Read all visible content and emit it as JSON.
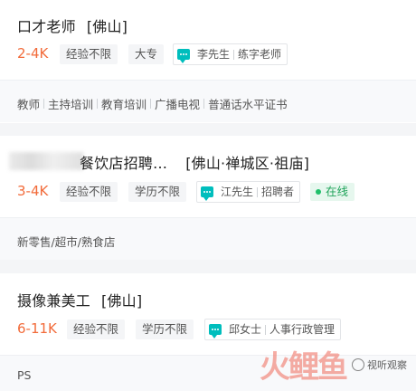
{
  "jobs": [
    {
      "title": "口才老师",
      "city": "[佛山]",
      "salary": "2-4K",
      "tags": [
        "经验不限",
        "大专"
      ],
      "recruiter_name": "李先生",
      "recruiter_role": "练字老师",
      "online": "",
      "industry": [
        "教师",
        "主持培训",
        "教育培训",
        "广播电视",
        "普通话水平证书"
      ]
    },
    {
      "title": "餐饮店招聘…",
      "city": "[佛山·禅城区·祖庙]",
      "salary": "3-4K",
      "tags": [
        "经验不限",
        "学历不限"
      ],
      "recruiter_name": "江先生",
      "recruiter_role": "招聘者",
      "online": "在线",
      "industry": [
        "新零售/超市/熟食店"
      ]
    },
    {
      "title": "摄像兼美工",
      "city": "[佛山]",
      "salary": "6-11K",
      "tags": [
        "经验不限",
        "学历不限"
      ],
      "recruiter_name": "邱女士",
      "recruiter_role": "人事行政管理",
      "online": "",
      "industry": [
        "PS"
      ]
    }
  ],
  "watermark": {
    "logo": "火鲤鱼",
    "badge": "视听观察"
  },
  "colors": {
    "salary": "#f26b3a",
    "accent": "#00bebd",
    "online": "#1fa35a",
    "background": "#f4f5f7"
  }
}
